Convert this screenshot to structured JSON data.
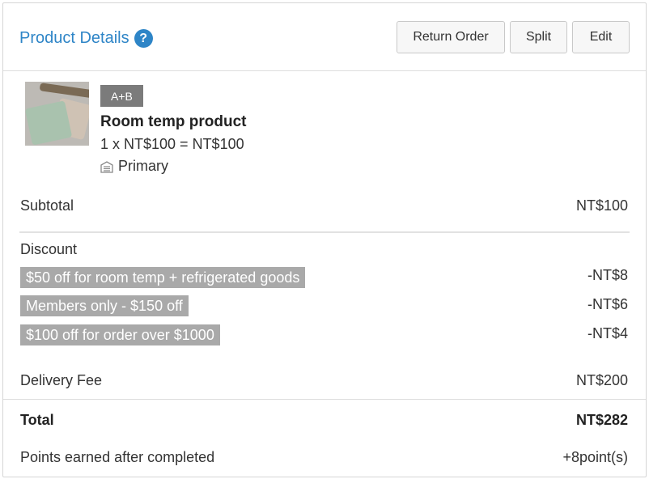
{
  "header": {
    "title": "Product Details",
    "help_glyph": "?",
    "buttons": {
      "return_order": "Return Order",
      "split": "Split",
      "edit": "Edit"
    }
  },
  "product": {
    "tag": "A+B",
    "name": "Room temp product",
    "price_line": "1 x NT$100 = NT$100",
    "warehouse": "Primary",
    "warehouse_icon": "warehouse-icon"
  },
  "summary": {
    "subtotal_label": "Subtotal",
    "subtotal_value": "NT$100",
    "discount_label": "Discount",
    "discounts": [
      {
        "label": "$50 off for room temp + refrigerated goods",
        "value": "-NT$8"
      },
      {
        "label": "Members only - $150 off",
        "value": "-NT$6"
      },
      {
        "label": "$100 off for order over $1000",
        "value": "-NT$4"
      }
    ],
    "delivery_label": "Delivery Fee",
    "delivery_value": "NT$200",
    "total_label": "Total",
    "total_value": "NT$282",
    "points_label": "Points earned after completed",
    "points_value": "+8point(s)"
  },
  "colors": {
    "accent": "#2e85c7",
    "tag_bg": "#7b7b7b",
    "promo_bg": "#a9a9a9"
  }
}
